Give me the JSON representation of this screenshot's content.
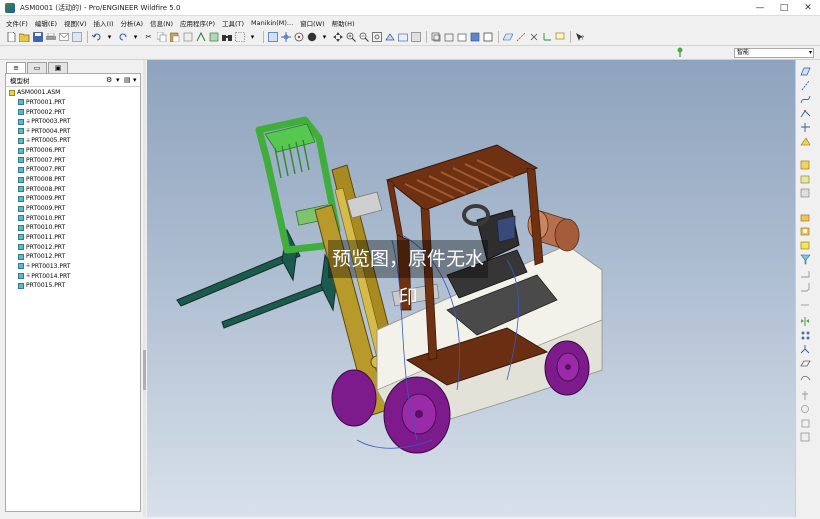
{
  "window": {
    "title": "ASM0001 (活动的) - Pro/ENGINEER Wildfire 5.0",
    "controls": [
      "—",
      "□",
      "✕"
    ]
  },
  "menu": [
    "文件(F)",
    "编辑(E)",
    "视图(V)",
    "插入(I)",
    "分析(A)",
    "信息(N)",
    "应用程序(P)",
    "工具(T)",
    "Manikin(M)...",
    "窗口(W)",
    "帮助(H)"
  ],
  "selection_filter": {
    "value": "智能"
  },
  "model_tree": {
    "header": "模型树",
    "root": "ASM0001.ASM",
    "items": [
      {
        "name": "PRT0001.PRT",
        "pinned": false
      },
      {
        "name": "PRT0002.PRT",
        "pinned": false
      },
      {
        "name": "PRT0003.PRT",
        "pinned": true
      },
      {
        "name": "PRT0004.PRT",
        "pinned": true
      },
      {
        "name": "PRT0005.PRT",
        "pinned": true
      },
      {
        "name": "PRT0006.PRT",
        "pinned": false
      },
      {
        "name": "PRT0007.PRT",
        "pinned": false
      },
      {
        "name": "PRT0007.PRT",
        "pinned": false
      },
      {
        "name": "PRT0008.PRT",
        "pinned": false
      },
      {
        "name": "PRT0008.PRT",
        "pinned": false
      },
      {
        "name": "PRT0009.PRT",
        "pinned": false
      },
      {
        "name": "PRT0009.PRT",
        "pinned": false
      },
      {
        "name": "PRT0010.PRT",
        "pinned": false
      },
      {
        "name": "PRT0010.PRT",
        "pinned": false
      },
      {
        "name": "PRT0011.PRT",
        "pinned": false
      },
      {
        "name": "PRT0012.PRT",
        "pinned": false
      },
      {
        "name": "PRT0012.PRT",
        "pinned": false
      },
      {
        "name": "PRT0013.PRT",
        "pinned": true
      },
      {
        "name": "PRT0014.PRT",
        "pinned": true
      },
      {
        "name": "PRT0015.PRT",
        "pinned": false
      }
    ]
  },
  "watermark": "预览图，原件无水印",
  "colors": {
    "viewport_top": "#8ea3bd",
    "viewport_bottom": "#d8e1ea",
    "mast_green": "#3fae3a",
    "cab_brown": "#6e3212",
    "wheel_purple": "#7d1a8c",
    "body_white": "#f2f2ea",
    "mast_yellow": "#b89a2a"
  }
}
